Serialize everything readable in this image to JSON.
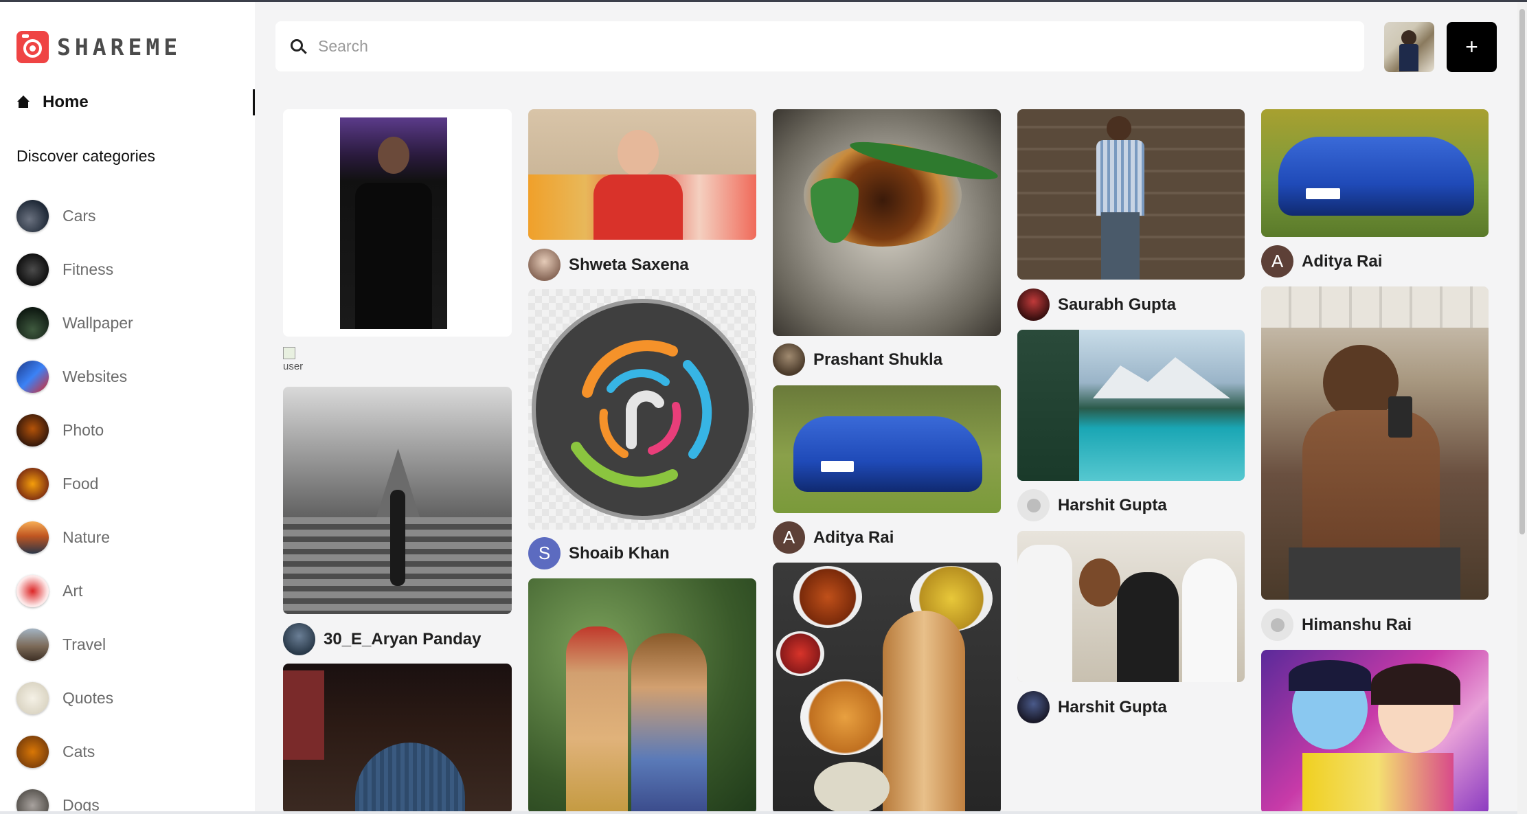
{
  "app": {
    "name": "SHAREME",
    "brand_color": "#ef4444"
  },
  "sidebar": {
    "home_label": "Home",
    "discover_title": "Discover categories",
    "categories": [
      {
        "label": "Cars"
      },
      {
        "label": "Fitness"
      },
      {
        "label": "Wallpaper"
      },
      {
        "label": "Websites"
      },
      {
        "label": "Photo"
      },
      {
        "label": "Food"
      },
      {
        "label": "Nature"
      },
      {
        "label": "Art"
      },
      {
        "label": "Travel"
      },
      {
        "label": "Quotes"
      },
      {
        "label": "Cats"
      },
      {
        "label": "Dogs"
      }
    ]
  },
  "header": {
    "search_placeholder": "Search",
    "add_label": "+"
  },
  "pins": {
    "broken_alt": "user",
    "users": [
      {
        "name": "Shweta Saxena",
        "initial": ""
      },
      {
        "name": "Shoaib Khan",
        "initial": "S"
      },
      {
        "name": "Prashant Shukla",
        "initial": ""
      },
      {
        "name": "Aditya Rai",
        "initial": "A"
      },
      {
        "name": "Saurabh Gupta",
        "initial": ""
      },
      {
        "name": "Harshit Gupta",
        "initial": ""
      },
      {
        "name": "Harshit Gupta",
        "initial": ""
      },
      {
        "name": "Aditya Rai",
        "initial": "A"
      },
      {
        "name": "Himanshu Rai",
        "initial": ""
      },
      {
        "name": "30_E_Aryan Panday",
        "initial": ""
      }
    ]
  }
}
